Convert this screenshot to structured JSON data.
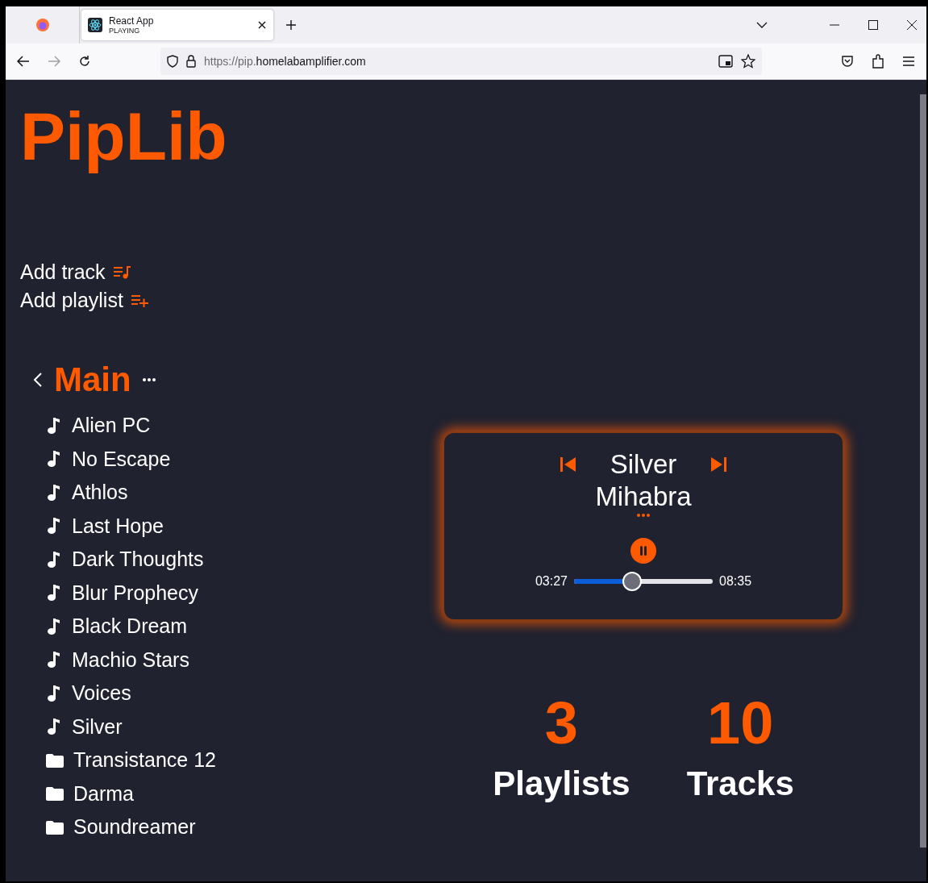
{
  "browser": {
    "tab": {
      "title": "React App",
      "subtitle": "PLAYING",
      "selected": true
    },
    "url": {
      "prefix": "https://pip.",
      "domain": "homelabamplifier.com"
    }
  },
  "app": {
    "logo": "PipLib",
    "actions": [
      {
        "label": "Add track",
        "kind": "track"
      },
      {
        "label": "Add playlist",
        "kind": "playlist"
      }
    ],
    "playlist": {
      "title": "Main",
      "items": [
        {
          "name": "Alien PC",
          "kind": "track"
        },
        {
          "name": "No Escape",
          "kind": "track"
        },
        {
          "name": "Athlos",
          "kind": "track"
        },
        {
          "name": "Last Hope",
          "kind": "track"
        },
        {
          "name": "Dark Thoughts",
          "kind": "track"
        },
        {
          "name": "Blur Prophecy",
          "kind": "track"
        },
        {
          "name": "Black Dream",
          "kind": "track"
        },
        {
          "name": "Machio Stars",
          "kind": "track"
        },
        {
          "name": "Voices",
          "kind": "track"
        },
        {
          "name": "Silver",
          "kind": "track"
        },
        {
          "name": "Transistance 12",
          "kind": "folder"
        },
        {
          "name": "Darma",
          "kind": "folder"
        },
        {
          "name": "Soundreamer",
          "kind": "folder"
        }
      ]
    },
    "player": {
      "title": "Silver",
      "artist": "Mihabra",
      "playing": true,
      "elapsed": "03:27",
      "duration": "08:35",
      "level": 0.41
    },
    "stats": [
      {
        "value": "3",
        "label": "Playlists"
      },
      {
        "value": "10",
        "label": "Tracks"
      }
    ]
  }
}
